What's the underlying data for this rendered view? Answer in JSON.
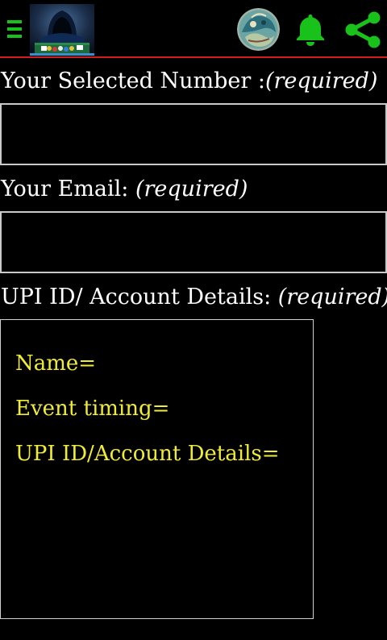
{
  "header": {
    "menu_icon": "hamburger-menu-icon",
    "logo_icon": "hacker-logo-image",
    "avatar_icon": "profile-avatar-image",
    "notification_icon": "bell-icon",
    "share_icon": "share-icon",
    "accent_color": "#19c21a",
    "divider_color": "#d11d1d"
  },
  "form": {
    "number_label": "Your Selected Number :",
    "number_required": "(required)",
    "number_value": "",
    "email_label": "Your Email: ",
    "email_required": "(required)",
    "email_value": "",
    "upi_label": "UPI ID/ Account Details: ",
    "upi_required": "(required)",
    "upi_lines": [
      "Name=",
      "Event timing=",
      "UPI ID/Account Details="
    ],
    "upi_text_color": "#f0ec35"
  }
}
